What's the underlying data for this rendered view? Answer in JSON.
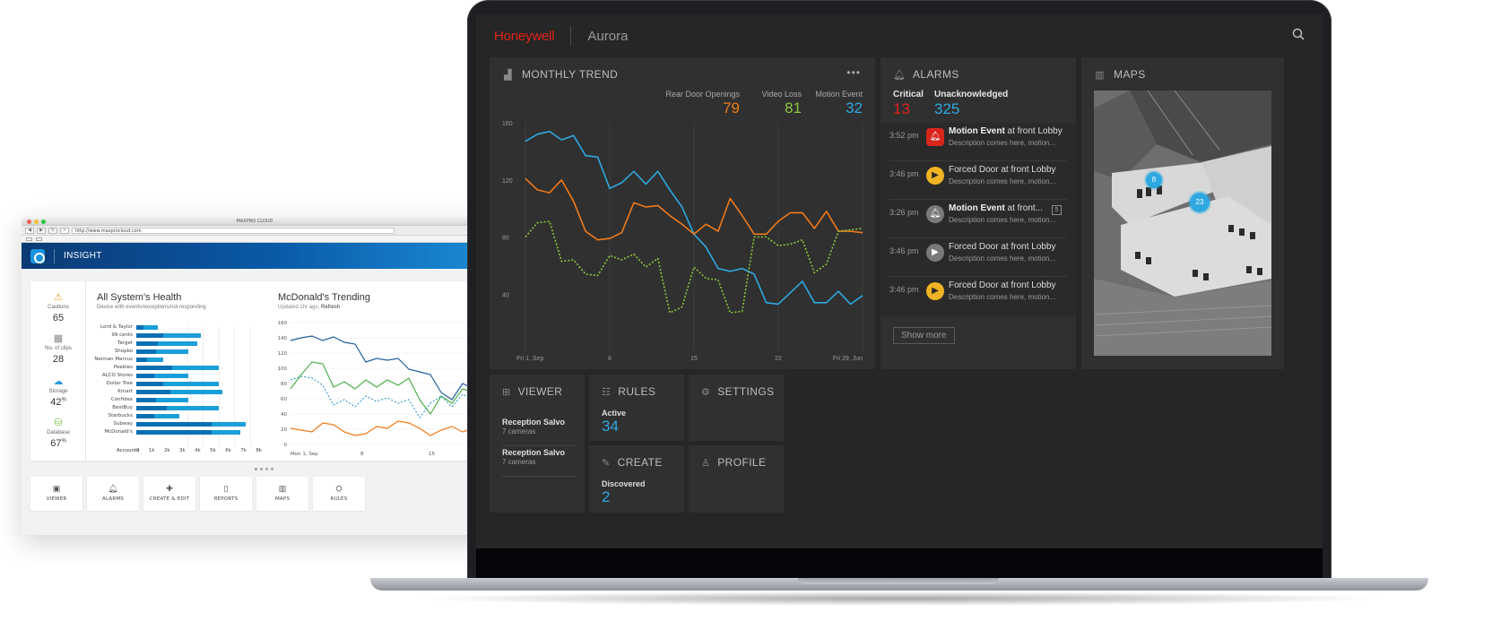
{
  "colors": {
    "brand_red": "#e2231a",
    "orange": "#f07a1a",
    "green": "#8cc63f",
    "blue": "#2ea8e0",
    "panel": "#303030"
  },
  "browser": {
    "window_title": "MAXPRO CLOUD",
    "url": "http://www.maxprocloud.com",
    "app_name": "INSIGHT",
    "stats": [
      {
        "icon": "warning-icon",
        "label": "Cautions",
        "value": "65",
        "suffix": ""
      },
      {
        "icon": "film-icon",
        "label": "No. of clips",
        "value": "28",
        "suffix": ""
      },
      {
        "icon": "cloud-icon",
        "label": "Storage",
        "value": "42",
        "suffix": "%"
      },
      {
        "icon": "database-icon",
        "label": "Database",
        "value": "67",
        "suffix": "%"
      }
    ],
    "health": {
      "title": "All System's Health",
      "subtitle": "Device with events/exceptions/not responding",
      "axis_label": "Accounts",
      "ticks": [
        "0",
        "1k",
        "2k",
        "3k",
        "4k",
        "5k",
        "6k",
        "7k",
        "8k"
      ]
    },
    "trending": {
      "title": "McDonald's Trending",
      "updated": "Updated 1hr ago,",
      "refresh": "Refresh",
      "y_ticks": [
        "160",
        "140",
        "120",
        "100",
        "80",
        "60",
        "40",
        "20",
        "0"
      ],
      "x_ticks": [
        "Mon 1, Sep",
        "8",
        "15"
      ]
    },
    "tiles": [
      {
        "icon": "camera-icon",
        "label": "VIEWER"
      },
      {
        "icon": "bell-icon",
        "label": "ALARMS"
      },
      {
        "icon": "plus-icon",
        "label": "CREATE & EDIT"
      },
      {
        "icon": "report-icon",
        "label": "REPORTS"
      },
      {
        "icon": "map-icon",
        "label": "MAPS"
      },
      {
        "icon": "rules-icon",
        "label": "RULES"
      }
    ]
  },
  "aurora": {
    "brand": "Honeywell",
    "product": "Aurora",
    "monthly_trend": {
      "title": "MONTHLY TREND",
      "legend": [
        {
          "label": "Rear Door Openings",
          "value": "79",
          "color": "#f07a1a"
        },
        {
          "label": "Video Loss",
          "value": "81",
          "color": "#8cc63f"
        },
        {
          "label": "Motion Event",
          "value": "32",
          "color": "#2ea8e0"
        }
      ]
    },
    "alarms": {
      "title": "ALARMS",
      "critical_label": "Critical",
      "critical_value": "13",
      "unack_label": "Unacknowledged",
      "unack_value": "325",
      "items": [
        {
          "time": "3:52 pm",
          "type": "red",
          "glyph": "🔔",
          "bold": "Motion Event",
          "rest": " at front Lobby",
          "desc": "Description comes here, motion...",
          "count": ""
        },
        {
          "time": "3:46 pm",
          "type": "yellow",
          "glyph": "■",
          "bold": "",
          "rest": "Forced Door at front Lobby",
          "desc": "Description comes here, motion...",
          "count": ""
        },
        {
          "time": "3:26 pm",
          "type": "grey",
          "glyph": "🔔",
          "bold": "Motion Event",
          "rest": " at front...",
          "desc": "Description comes here, motion...",
          "count": "5"
        },
        {
          "time": "3:46 pm",
          "type": "grey",
          "glyph": "■",
          "bold": "",
          "rest": "Forced Door at front Lobby",
          "desc": "Description comes here, motion...",
          "count": ""
        },
        {
          "time": "3:46 pm",
          "type": "yellow",
          "glyph": "■",
          "bold": "",
          "rest": "Forced Door at front Lobby",
          "desc": "Description comes here, motion...",
          "count": ""
        }
      ],
      "show_more": "Show more"
    },
    "maps": {
      "title": "MAPS",
      "markers": [
        "8",
        "23"
      ]
    },
    "viewer": {
      "title": "VIEWER",
      "items": [
        {
          "name": "Reception Salvo",
          "count": "7 cameras"
        },
        {
          "name": "Reception Salvo",
          "count": "7 cameras"
        }
      ]
    },
    "rules": {
      "title": "RULES",
      "sub": "Active",
      "value": "34"
    },
    "settings": {
      "title": "SETTINGS"
    },
    "create": {
      "title": "CREATE",
      "sub": "Discovered",
      "value": "2"
    },
    "profile": {
      "title": "PROFILE"
    }
  },
  "chart_data": [
    {
      "type": "line",
      "title": "MONTHLY TREND",
      "x_tick_labels": [
        "Fri 1, Sep",
        "8",
        "15",
        "22",
        "Fri 29, Jun"
      ],
      "y_ticks": [
        40,
        80,
        120,
        160
      ],
      "ylim": [
        0,
        160
      ],
      "x": [
        1,
        2,
        3,
        4,
        5,
        6,
        7,
        8,
        9,
        10,
        11,
        12,
        13,
        14,
        15,
        16,
        17,
        18,
        19,
        20,
        21,
        22,
        23,
        24,
        25,
        26,
        27,
        28,
        29
      ],
      "series": [
        {
          "name": "Motion Event",
          "color": "#2ea8e0",
          "style": "solid",
          "values": [
            147,
            152,
            154,
            148,
            151,
            137,
            136,
            114,
            118,
            126,
            117,
            126,
            113,
            101,
            82,
            73,
            58,
            56,
            58,
            54,
            34,
            33,
            41,
            49,
            34,
            34,
            42,
            33,
            39
          ]
        },
        {
          "name": "Rear Door Openings",
          "color": "#f07a1a",
          "style": "solid",
          "values": [
            121,
            113,
            111,
            120,
            105,
            84,
            78,
            79,
            83,
            104,
            101,
            102,
            95,
            89,
            82,
            89,
            84,
            107,
            95,
            82,
            82,
            91,
            97,
            97,
            86,
            98,
            84,
            84,
            83
          ]
        },
        {
          "name": "Video Loss",
          "color": "#8cc63f",
          "style": "dotted",
          "values": [
            80,
            90,
            91,
            63,
            64,
            54,
            53,
            67,
            64,
            68,
            59,
            65,
            27,
            31,
            59,
            51,
            50,
            27,
            28,
            80,
            80,
            74,
            75,
            78,
            55,
            61,
            84,
            85,
            86
          ]
        }
      ]
    }
  ]
}
